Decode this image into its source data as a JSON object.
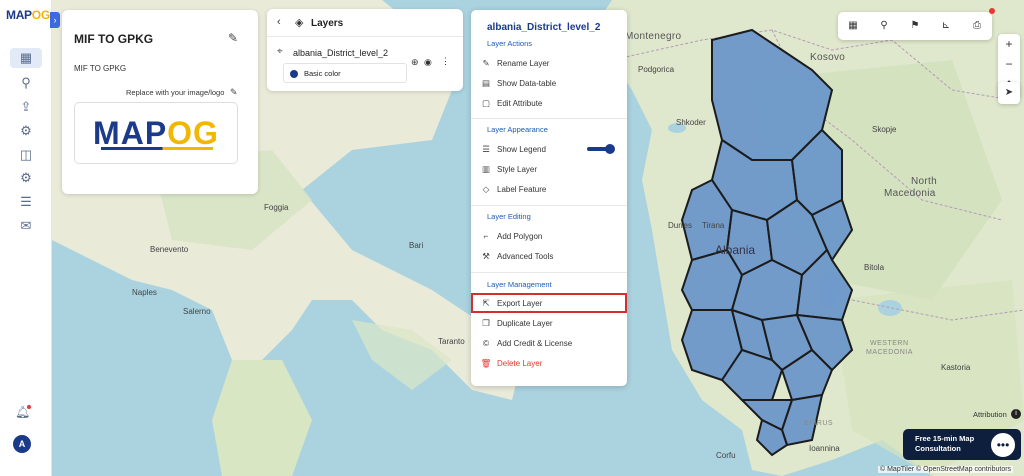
{
  "app": {
    "logo_main": "MAP",
    "logo_accent": "OG"
  },
  "project": {
    "title": "MIF TO GPKG",
    "description": "MIF TO GPKG",
    "replace_logo_label": "Replace with your image/logo",
    "logo_main": "MAP",
    "logo_accent": "OG"
  },
  "layers_panel": {
    "title": "Layers",
    "layer_name": "albania_District_level_2",
    "legend_label": "Basic color"
  },
  "actions_menu": {
    "title": "albania_District_level_2",
    "sections": {
      "actions": "Layer Actions",
      "appearance": "Layer Appearance",
      "editing": "Layer Editing",
      "management": "Layer Management"
    },
    "items": {
      "rename": "Rename Layer",
      "datatable": "Show Data-table",
      "edit_attr": "Edit Attribute",
      "show_legend": "Show Legend",
      "style": "Style Layer",
      "label": "Label Feature",
      "add_polygon": "Add Polygon",
      "advanced": "Advanced Tools",
      "export": "Export Layer",
      "duplicate": "Duplicate Layer",
      "credit": "Add Credit & License",
      "delete": "Delete Layer"
    },
    "show_legend_enabled": true
  },
  "map_labels": {
    "montenegro": "Montenegro",
    "kosovo": "Kosovo",
    "podgorica": "Podgorica",
    "skopje": "Skopje",
    "north_macedonia_1": "North",
    "north_macedonia_2": "Macedonia",
    "foggia": "Foggia",
    "benevento": "Benevento",
    "naples": "Naples",
    "salerno": "Salerno",
    "bari": "Bari",
    "taranto": "Taranto",
    "shkoder": "Shkoder",
    "durres": "Durres",
    "tirana": "Tirana",
    "albania": "Albania",
    "bitola": "Bitola",
    "kastoria": "Kastoria",
    "ioannina": "Ioannina",
    "corfu": "Corfu",
    "western_macedonia_1": "WESTERN",
    "western_macedonia_2": "MACEDONIA",
    "epirus": "EPIRUS"
  },
  "attribution_label": "Attribution",
  "consult_text": "Free 15-min Map Consultation",
  "map_credits": "© MapTiler © OpenStreetMap contributors",
  "user_initial": "A",
  "colors": {
    "brand": "#1b3a8a",
    "accent": "#f2b705",
    "layer_fill": "#6b97c9",
    "highlight": "#d32f2f"
  }
}
